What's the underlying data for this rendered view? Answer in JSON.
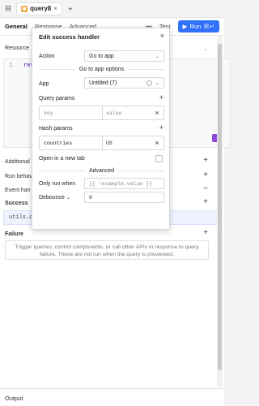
{
  "topbar": {
    "query_name": "query8",
    "add_icon": "plus-icon"
  },
  "tabs": {
    "general": "General",
    "response": "Response",
    "advanced": "Advanced",
    "test": "Test",
    "run": "Run",
    "run_shortcut": "⌘↵"
  },
  "main": {
    "resource_label": "Resource",
    "editor_line": "1",
    "editor_code": "ret",
    "additional_label": "Additional",
    "run_behavior_label": "Run behav",
    "event_handlers_label": "Event han",
    "success_label": "Success",
    "success_code": "utils.openApp()",
    "failure_label": "Failure",
    "failure_text": "Trigger queries, control components, or call other APIs in response to query failure. These are not run when the query is previewed.",
    "output_label": "Output"
  },
  "modal": {
    "title": "Edit success handler",
    "action_label": "Action",
    "action_value": "Go to app",
    "go_to_app_options": "Go to app options",
    "app_label": "App",
    "app_value": "Untitled (7)",
    "query_params_label": "Query params",
    "query_key_placeholder": "key",
    "query_value_placeholder": "value",
    "hash_params_label": "Hash params",
    "hash_key": "countries",
    "hash_value": "US",
    "open_new_tab_label": "Open in a new tab",
    "advanced_label": "Advanced",
    "only_run_when_label": "Only run when",
    "only_run_when_placeholder": "{{ !example.value }}",
    "debounce_label": "Debounce",
    "debounce_value": "0"
  },
  "colors": {
    "accent": "#3170f9",
    "query_icon": "#f2a640",
    "badge": "#8b4ad8"
  }
}
